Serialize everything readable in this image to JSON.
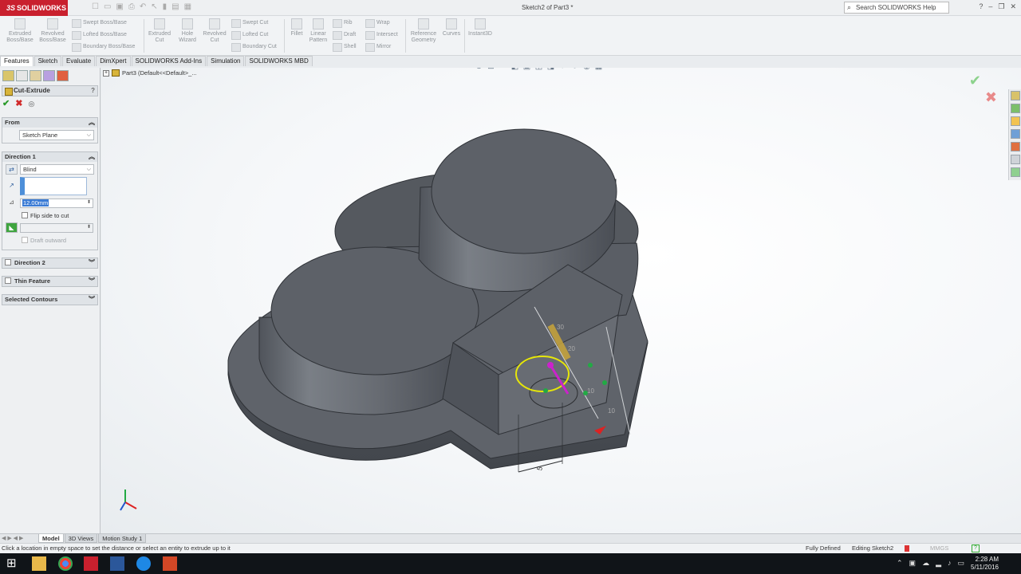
{
  "app": {
    "brand": "SOLIDWORKS",
    "document_title": "Sketch2 of Part3 *",
    "search_placeholder": "Search SOLIDWORKS Help"
  },
  "command_manager": {
    "big_buttons": [
      {
        "id": "extruded-boss",
        "label": "Extruded\nBoss/Base"
      },
      {
        "id": "revolved-boss",
        "label": "Revolved\nBoss/Base"
      },
      {
        "id": "extruded-cut",
        "label": "Extruded\nCut"
      },
      {
        "id": "hole-wizard",
        "label": "Hole\nWizard"
      },
      {
        "id": "revolved-cut",
        "label": "Revolved\nCut"
      },
      {
        "id": "fillet",
        "label": "Fillet"
      },
      {
        "id": "linear-pattern",
        "label": "Linear\nPattern"
      },
      {
        "id": "reference-geometry",
        "label": "Reference\nGeometry"
      },
      {
        "id": "curves",
        "label": "Curves"
      },
      {
        "id": "instant3d",
        "label": "Instant3D"
      }
    ],
    "small_buttons": {
      "swept_boss": "Swept Boss/Base",
      "lofted_boss": "Lofted Boss/Base",
      "boundary_boss": "Boundary Boss/Base",
      "swept_cut": "Swept Cut",
      "lofted_cut": "Lofted Cut",
      "boundary_cut": "Boundary Cut",
      "rib": "Rib",
      "draft": "Draft",
      "shell": "Shell",
      "wrap": "Wrap",
      "intersect": "Intersect",
      "mirror": "Mirror"
    },
    "tabs": [
      "Features",
      "Sketch",
      "Evaluate",
      "DimXpert",
      "SOLIDWORKS Add-Ins",
      "Simulation",
      "SOLIDWORKS MBD"
    ]
  },
  "property_manager": {
    "title": "Cut-Extrude",
    "help_glyph": "?",
    "ok_glyph": "✔",
    "cancel_glyph": "✖",
    "from_group": {
      "title": "From",
      "value": "Sketch Plane"
    },
    "direction1": {
      "title": "Direction 1",
      "end_condition": "Blind",
      "depth": "12.00mm",
      "flip_side": "Flip side to cut",
      "draft_outward": "Draft outward"
    },
    "direction2": "Direction 2",
    "thin_feature": "Thin Feature",
    "selected_contours": "Selected Contours"
  },
  "graphics": {
    "tree_root": "Part3  (Default<<Default>_...",
    "ruler_labels": [
      "30",
      "20",
      "10",
      "10"
    ],
    "dim_label": "5"
  },
  "bottom_tabs": [
    "Model",
    "3D Views",
    "Motion Study 1"
  ],
  "status_bar": {
    "message": "Click a location in empty space to set the distance or select an entity to extrude up to it",
    "definition": "Fully Defined",
    "editing": "Editing Sketch2",
    "units": "MMGS"
  },
  "taskbar": {
    "time": "2:28 AM",
    "date": "5/11/2016"
  },
  "colors": {
    "brand_red": "#c9202e",
    "model_face": "#5d6168",
    "model_dark": "#484c52",
    "sketch_yellow": "#e6e60a",
    "dim_magenta": "#cc22cc",
    "relation_green": "#22aa44"
  }
}
